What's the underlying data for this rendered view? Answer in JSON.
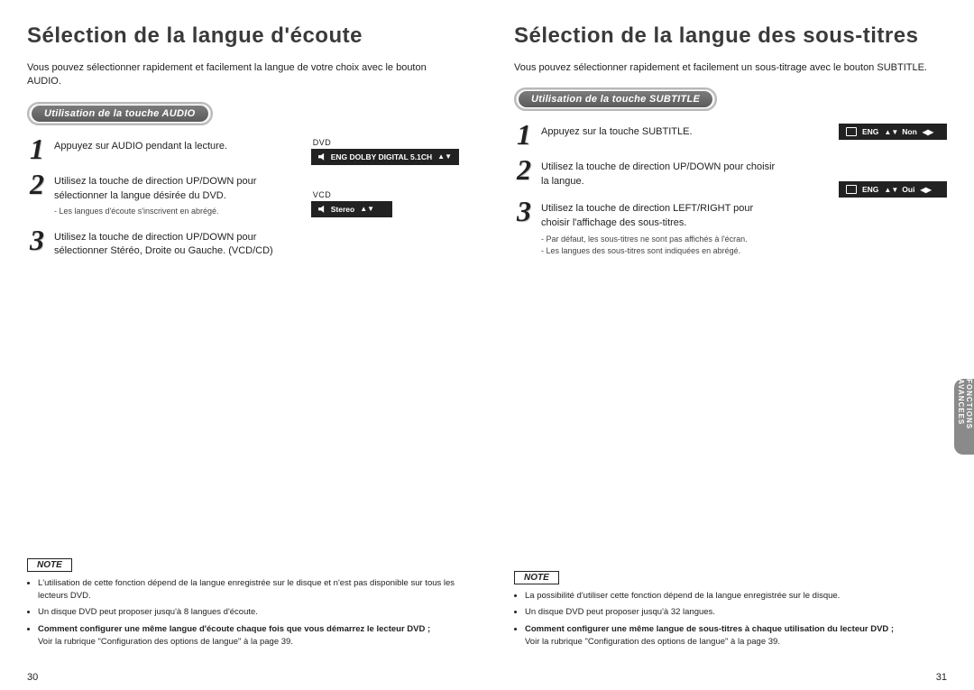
{
  "side_tab": "FONCTIONS  AVANCEES",
  "left": {
    "title": "Sélection de la langue d'écoute",
    "intro": "Vous pouvez sélectionner rapidement et facilement la langue de votre choix avec le bouton AUDIO.",
    "pill": "Utilisation de la touche AUDIO",
    "steps": [
      {
        "num": "1",
        "text": "Appuyez sur AUDIO pendant la lecture."
      },
      {
        "num": "2",
        "text": "Utilisez la touche de direction UP/DOWN pour sélectionner la langue désirée du DVD.",
        "sub": "- Les langues d'écoute s'inscrivent en abrégé."
      },
      {
        "num": "3",
        "text": "Utilisez la touche de direction UP/DOWN pour sélectionner Stéréo, Droite ou Gauche. (VCD/CD)"
      }
    ],
    "osd": {
      "label1": "DVD",
      "val1": "ENG  DOLBY  DIGITAL  5.1CH",
      "label2": "VCD",
      "val2": "Stereo"
    },
    "note_label": "NOTE",
    "notes": [
      "L'utilisation de cette fonction dépend de la langue enregistrée sur le disque et n'est pas disponible sur tous les lecteurs DVD.",
      "Un disque DVD peut proposer jusqu'à 8 langues d'écoute.",
      "Comment configurer une même langue d'écoute chaque fois que vous démarrez le lecteur DVD ;",
      "Voir la rubrique \"Configuration des options de langue\" à la page 39."
    ],
    "page_num": "30"
  },
  "right": {
    "title": "Sélection de la langue des sous-titres",
    "intro": "Vous pouvez sélectionner rapidement et facilement un sous-titrage avec le bouton SUBTITLE.",
    "pill": "Utilisation de la touche SUBTITLE",
    "steps": [
      {
        "num": "1",
        "text": "Appuyez sur la touche SUBTITLE."
      },
      {
        "num": "2",
        "text": "Utilisez la touche de direction UP/DOWN pour choisir la langue."
      },
      {
        "num": "3",
        "text": "Utilisez la touche de direction LEFT/RIGHT pour choisir l'affichage des sous-titres.",
        "sub": "- Par défaut, les sous-titres ne sont pas affichés à l'écran.\n- Les langues des sous-titres sont indiquées en abrégé."
      }
    ],
    "osd": {
      "val1_lang": "ENG",
      "val1_tog": "Non",
      "val2_lang": "ENG",
      "val2_tog": "Oui"
    },
    "note_label": "NOTE",
    "notes": [
      "La possibilité d'utiliser cette fonction dépend de la langue enregistrée sur le disque.",
      "Un disque DVD peut proposer jusqu'à 32 langues.",
      "Comment configurer une même langue de sous-titres à chaque utilisation du lecteur DVD ;",
      "Voir la rubrique \"Configuration des options de langue\" à la page 39."
    ],
    "page_num": "31"
  }
}
